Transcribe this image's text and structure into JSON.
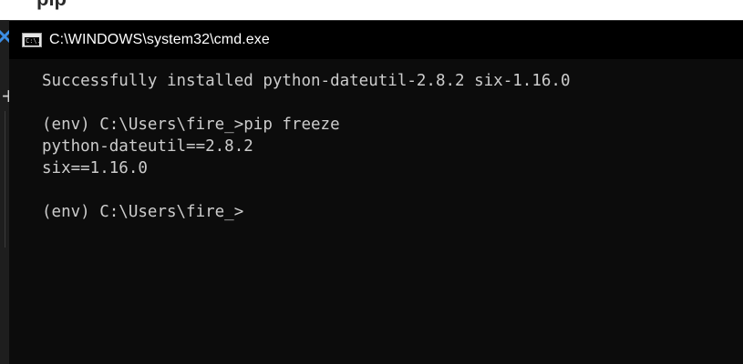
{
  "background_page": {
    "text_before": "      ",
    "text_bold": "pip",
    "text_after": " "
  },
  "window": {
    "title": "C:\\WINDOWS\\system32\\cmd.exe",
    "icon": "cmd-icon",
    "icon_label": "C:\\."
  },
  "console": {
    "lines": [
      "Successfully installed python-dateutil-2.8.2 six-1.16.0",
      "",
      "(env) C:\\Users\\fire_>pip freeze",
      "python-dateutil==2.8.2",
      "six==1.16.0",
      "",
      "(env) C:\\Users\\fire_>"
    ]
  },
  "sidebar": {
    "close_icon": "blue-x-icon",
    "add_icon": "plus-icon"
  },
  "colors": {
    "console_bg": "#0c0c0c",
    "console_text": "#cccccc",
    "titlebar_bg": "#000000",
    "accent_blue": "#3c8ee6"
  }
}
